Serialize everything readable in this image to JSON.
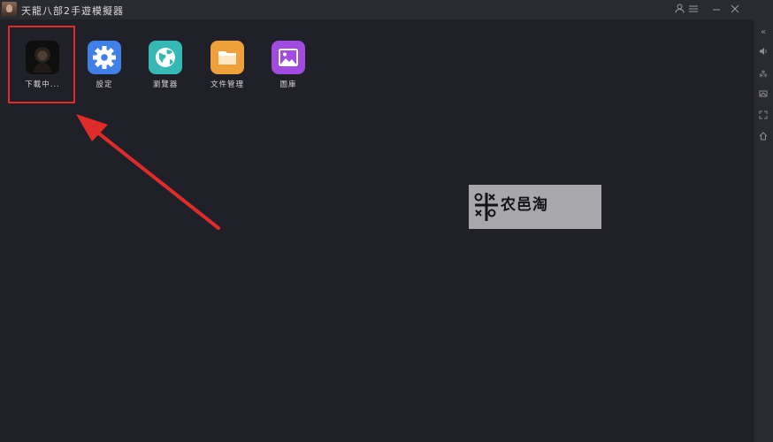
{
  "window": {
    "title": "天龍八部2手遊模擬器",
    "controls": {
      "account": "account-icon",
      "menu": "menu-icon",
      "minimize": "minimize-icon",
      "close": "close-icon"
    }
  },
  "sidebar": {
    "items": [
      {
        "icon": "collapse-icon",
        "glyph": "«"
      },
      {
        "icon": "volume-icon",
        "glyph": "◀"
      },
      {
        "icon": "gamepad-icon",
        "glyph": "⁂"
      },
      {
        "icon": "screenshot-icon",
        "glyph": "▱"
      },
      {
        "icon": "fullscreen-icon",
        "glyph": "⤧"
      },
      {
        "icon": "home-icon",
        "glyph": "⌂"
      }
    ]
  },
  "desktop": {
    "icons": [
      {
        "label": "下載中...",
        "icon": "game-download-icon",
        "color": "#1a1a1a"
      },
      {
        "label": "設定",
        "icon": "settings-icon",
        "color": "#3f7fe6"
      },
      {
        "label": "瀏覽器",
        "icon": "browser-icon",
        "color": "#36b9b4"
      },
      {
        "label": "文件管理",
        "icon": "folder-icon",
        "color": "#f0a03a"
      },
      {
        "label": "圖庫",
        "icon": "gallery-icon",
        "color": "#a24be0"
      }
    ]
  },
  "annotation": {
    "highlight_color": "#e12b2b"
  },
  "watermark": {
    "text": "农邑淘"
  }
}
